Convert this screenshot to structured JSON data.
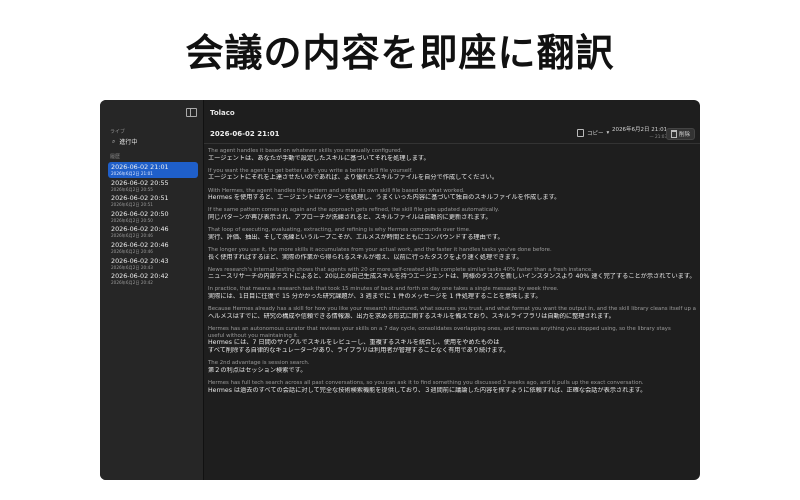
{
  "headline": "会議の内容を即座に翻訳",
  "app": {
    "title": "Tolaco"
  },
  "sidebar": {
    "live_section": "ライブ",
    "live_item": "進行中",
    "history_section": "履歴",
    "sessions": [
      {
        "title": "2026-06-02 21:01",
        "subtitle": "2026年6月2日 21:01",
        "active": true
      },
      {
        "title": "2026-06-02 20:55",
        "subtitle": "2026年6月2日 20:55"
      },
      {
        "title": "2026-06-02 20:51",
        "subtitle": "2026年6月2日 20:51"
      },
      {
        "title": "2026-06-02 20:50",
        "subtitle": "2026年6月2日 20:50"
      },
      {
        "title": "2026-06-02 20:46",
        "subtitle": "2026年6月2日 20:46"
      },
      {
        "title": "2026-06-02 20:46",
        "subtitle": "2026年6月2日 20:46"
      },
      {
        "title": "2026-06-02 20:43",
        "subtitle": "2026年6月2日 20:43"
      },
      {
        "title": "2026-06-02 20:42",
        "subtitle": "2026年6月2日 20:42"
      }
    ]
  },
  "toolbar": {
    "doc_title": "2026-06-02 21:01",
    "copy_label": "コピー",
    "date_main": "2026年6月2日 21:01",
    "date_sub": "— 21:03",
    "delete_label": "削除"
  },
  "transcript": [
    {
      "en": "The agent handles it based on whatever skills you manually configured.",
      "ja": "エージェントは、あなたが手動で設定したスキルに基づいてそれを処理します。"
    },
    {
      "en": "If you want the agent to get better at it, you write a better skill file yourself.",
      "ja": "エージェントにそれを上達させたいのであれば、より優れたスキルファイルを自分で作成してください。"
    },
    {
      "en": "With Hermes, the agent handles the pattern and writes its own skill file based on what worked.",
      "ja": "Hermes を使用すると、エージェントはパターンを処理し、うまくいった内容に基づいて独自のスキルファイルを作成します。"
    },
    {
      "en": "If the same pattern comes up again and the approach gets refined, the skill file gets updated automatically.",
      "ja": "同じパターンが再び表示され、アプローチが洗練されると、スキルファイルは自動的に更新されます。"
    },
    {
      "en": "That loop of executing, evaluating, extracting, and refining is why Hermes compounds over time.",
      "ja": "実行、評価、抽出、そして洗練というループこそが、エルメスが時間とともにコンパウンドする理由です。"
    },
    {
      "en": "The longer you use it, the more skills it accumulates from your actual work, and the faster it handles tasks you've done before.",
      "ja": "長く使用すればするほど、実際の作業から得られるスキルが増え、以前に行ったタスクをより速く処理できます。"
    },
    {
      "en": "News research's internal testing shows that agents with 20 or more self-created skills complete similar tasks 40% faster than a fresh instance.",
      "ja": "ニュースリサーチの内部テストによると、20以上の自己生成スキルを持つエージェントは、同様のタスクを新しいインスタンスより 40% 速く完了することが示されています。"
    },
    {
      "en": "In practice, that means a research task that took 15 minutes of back and forth on day one takes a single message by week three.",
      "ja": "実際には、1日目に往復で 15 分かかった研究課題が、3 週までに 1 件のメッセージを 1 件処理することを意味します。"
    },
    {
      "en": "Because Hermes already has a skill for how you like your research structured, what sources you trust, and what format you want the output in, and the skill library cleans itself up automatically.",
      "ja": "ヘルメスはすでに、研究の構成や信頼できる情報源、出力を求める形式に関するスキルを備えており、スキルライブラリは自動的に整理されます。"
    },
    {
      "en": "Hermes has an autonomous curator that reviews your skills on a 7 day cycle, consolidates overlapping ones, and removes anything you stopped using, so the library stays",
      "en2": "useful without you maintaining it.",
      "ja": "Hermes には、7 日間のサイクルでスキルをレビューし、重複するスキルを統合し、使用をやめたものは",
      "ja2": "すべて削除する自律的なキュレーターがあり、ライブラリは利用者が管理することなく有用であり続けます。"
    },
    {
      "en": "The 2nd advantage is session search.",
      "ja": "第２の利点はセッション検索です。"
    },
    {
      "en": "Hermes has full tech search across all past conversations, so you can ask it to find something you discussed 3 weeks ago, and it pulls up the exact conversation.",
      "ja": "Hermes は過去のすべての会話に対して完全な技術検索機能を提供しており、３週間前に議論した内容を探すように依頼すれば、正確な会話が表示されます。"
    }
  ]
}
